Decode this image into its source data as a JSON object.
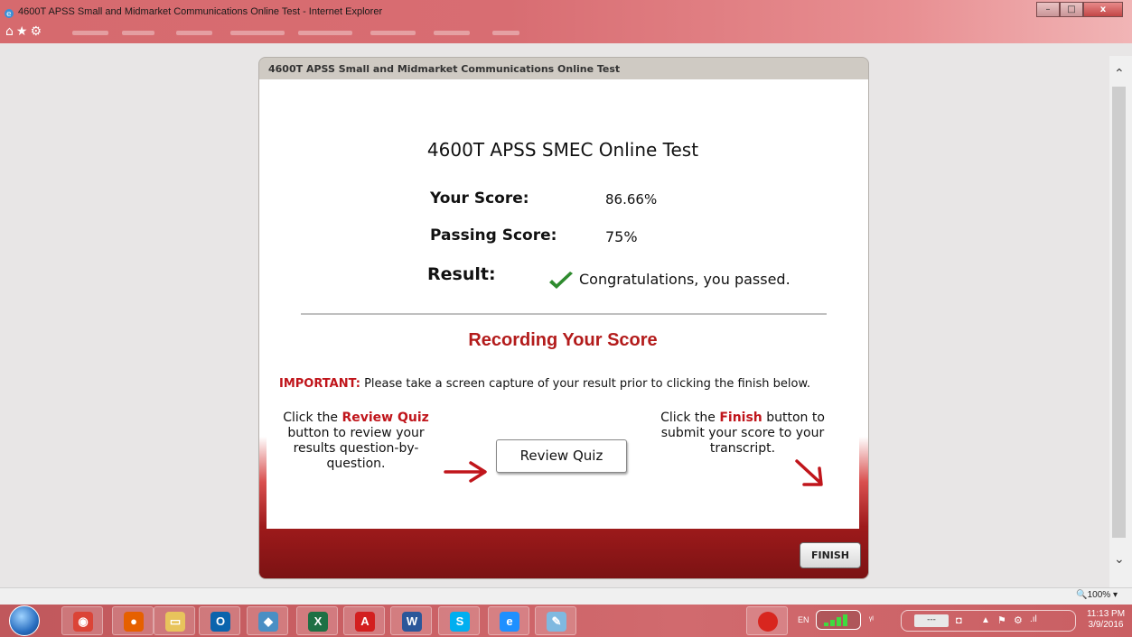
{
  "window": {
    "title": "4600T APSS Small and Midmarket Communications Online Test - Internet Explorer",
    "favorites_glyphs": "⌂★⚙",
    "minimize": "–",
    "maximize": "□",
    "close": "x"
  },
  "quiz": {
    "frame_title": "4600T APSS Small and Midmarket Communications Online Test",
    "heading": "4600T APSS SMEC Online Test",
    "your_score_label": "Your Score:",
    "your_score_value": "86.66%",
    "passing_score_label": "Passing Score:",
    "passing_score_value": "75%",
    "result_label": "Result:",
    "result_value": "Congratulations, you passed.",
    "recording_heading": "Recording Your Score",
    "important_label": "IMPORTANT:",
    "important_text": " Please take a screen capture of your result prior to clicking the finish below.",
    "review_instr_pre": "Click the ",
    "review_instr_kw": "Review Quiz",
    "review_instr_post": "button to review your results question-by-question.",
    "finish_instr_pre": "Click the ",
    "finish_instr_kw": "Finish",
    "finish_instr_post": " button to submit your score to your transcript.",
    "review_button": "Review Quiz",
    "finish_button": "FINISH"
  },
  "statusbar": {
    "zoom": "🔍100%  ▾"
  },
  "taskbar": {
    "apps": [
      {
        "name": "chrome",
        "glyph": "◉",
        "color": "#db4437"
      },
      {
        "name": "firefox",
        "glyph": "●",
        "color": "#e66000"
      },
      {
        "name": "explorer",
        "glyph": "▭",
        "color": "#e8c45c"
      },
      {
        "name": "outlook",
        "glyph": "O",
        "color": "#0a64ad"
      },
      {
        "name": "app",
        "glyph": "◆",
        "color": "#4a8fc4"
      },
      {
        "name": "excel",
        "glyph": "X",
        "color": "#1d7044"
      },
      {
        "name": "acrobat",
        "glyph": "A",
        "color": "#d31f1f"
      },
      {
        "name": "word",
        "glyph": "W",
        "color": "#2b579a"
      },
      {
        "name": "skype",
        "glyph": "S",
        "color": "#00aff0"
      },
      {
        "name": "internet-explorer",
        "glyph": "e",
        "color": "#1e90ff"
      },
      {
        "name": "paint",
        "glyph": "✎",
        "color": "#7fb9e0"
      }
    ],
    "language": "EN",
    "time": "11:13 PM",
    "date": "3/9/2016"
  }
}
